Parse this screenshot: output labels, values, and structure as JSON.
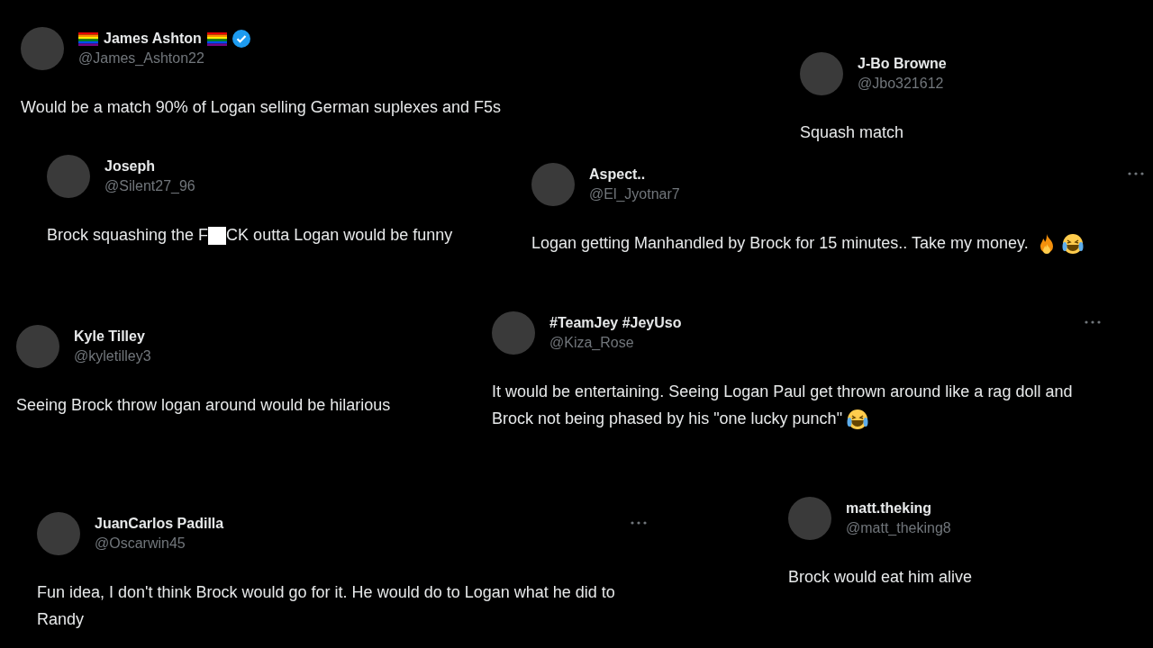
{
  "tweets": [
    {
      "name": "James Ashton",
      "handle": "@James_Ashton22",
      "flag_before": true,
      "flag_after": true,
      "verified": true,
      "more_menu": false,
      "body": [
        {
          "kind": "text",
          "text": "Would be a match 90% of Logan selling German suplexes and F5s"
        }
      ]
    },
    {
      "name": "J-Bo Browne",
      "handle": "@Jbo321612",
      "flag_before": false,
      "flag_after": false,
      "verified": false,
      "more_menu": false,
      "body": [
        {
          "kind": "text",
          "text": "Squash match"
        }
      ]
    },
    {
      "name": "Joseph",
      "handle": "@Silent27_96",
      "flag_before": false,
      "flag_after": false,
      "verified": false,
      "more_menu": false,
      "body": [
        {
          "kind": "text",
          "text": "Brock squashing the F"
        },
        {
          "kind": "censor"
        },
        {
          "kind": "text",
          "text": "CK outta Logan would be funny"
        }
      ]
    },
    {
      "name": "Aspect..",
      "handle": "@El_Jyotnar7",
      "flag_before": false,
      "flag_after": false,
      "verified": false,
      "more_menu": true,
      "body": [
        {
          "kind": "text",
          "text": "Logan getting Manhandled by Brock for 15 minutes.. Take my money."
        },
        {
          "kind": "fire"
        },
        {
          "kind": "laugh"
        }
      ]
    },
    {
      "name": "Kyle Tilley",
      "handle": "@kyletilley3",
      "flag_before": false,
      "flag_after": false,
      "verified": false,
      "more_menu": false,
      "body": [
        {
          "kind": "text",
          "text": "Seeing Brock throw logan around would be hilarious"
        }
      ]
    },
    {
      "name": "#TeamJey #JeyUso",
      "handle": "@Kiza_Rose",
      "flag_before": false,
      "flag_after": false,
      "verified": false,
      "more_menu": true,
      "body": [
        {
          "kind": "text",
          "text": "It would be entertaining. Seeing Logan Paul get thrown around like a rag doll and Brock not being phased by his \"one lucky punch\""
        },
        {
          "kind": "laugh"
        }
      ]
    },
    {
      "name": "JuanCarlos Padilla",
      "handle": "@Oscarwin45",
      "flag_before": false,
      "flag_after": false,
      "verified": false,
      "more_menu": true,
      "body": [
        {
          "kind": "text",
          "text": "Fun idea, I don't think Brock would go for it. He would do to Logan what he did to Randy"
        }
      ]
    },
    {
      "name": "matt.theking",
      "handle": "@matt_theking8",
      "flag_before": false,
      "flag_after": false,
      "verified": false,
      "more_menu": false,
      "body": [
        {
          "kind": "text",
          "text": "Brock would eat him alive"
        }
      ]
    }
  ]
}
